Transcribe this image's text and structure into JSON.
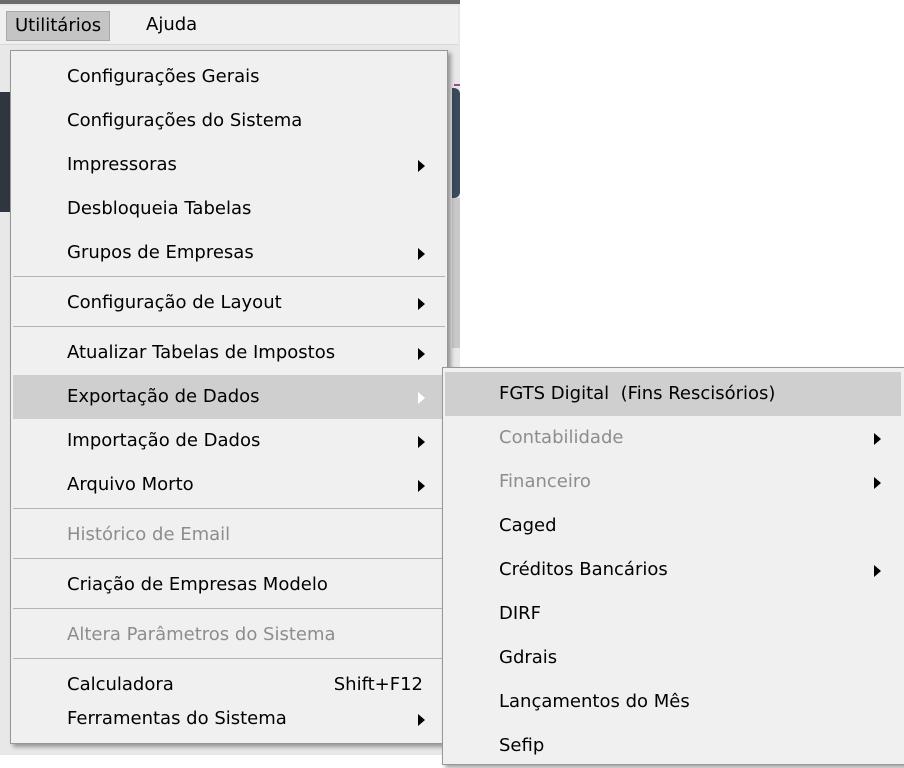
{
  "menubar": {
    "items": [
      {
        "label": "Utilitários"
      },
      {
        "label": "Ajuda"
      }
    ]
  },
  "utilitarios_menu": {
    "items": [
      {
        "label": "Configurações Gerais"
      },
      {
        "label": "Configurações do Sistema"
      },
      {
        "label": "Impressoras"
      },
      {
        "label": "Desbloqueia Tabelas"
      },
      {
        "label": "Grupos de Empresas"
      },
      {
        "label": "Configuração de Layout"
      },
      {
        "label": "Atualizar Tabelas de Impostos"
      },
      {
        "label": "Exportação de Dados"
      },
      {
        "label": "Importação de Dados"
      },
      {
        "label": "Arquivo Morto"
      },
      {
        "label": "Histórico de Email"
      },
      {
        "label": "Criação de Empresas Modelo"
      },
      {
        "label": "Altera Parâmetros do Sistema"
      },
      {
        "label": "Calculadora",
        "shortcut": "Shift+F12"
      },
      {
        "label": "Ferramentas do Sistema"
      }
    ]
  },
  "exportacao_submenu": {
    "items": [
      {
        "label": "FGTS Digital  (Fins Rescisórios)"
      },
      {
        "label": "Contabilidade"
      },
      {
        "label": "Financeiro"
      },
      {
        "label": "Caged"
      },
      {
        "label": "Créditos Bancários"
      },
      {
        "label": "DIRF"
      },
      {
        "label": "Gdrais"
      },
      {
        "label": "Lançamentos do Mês"
      },
      {
        "label": "Sefip"
      }
    ]
  },
  "colors": {
    "menu_background": "#f0f0f0",
    "highlight": "#cfcfcf",
    "disabled_text": "#8d8d8d"
  }
}
